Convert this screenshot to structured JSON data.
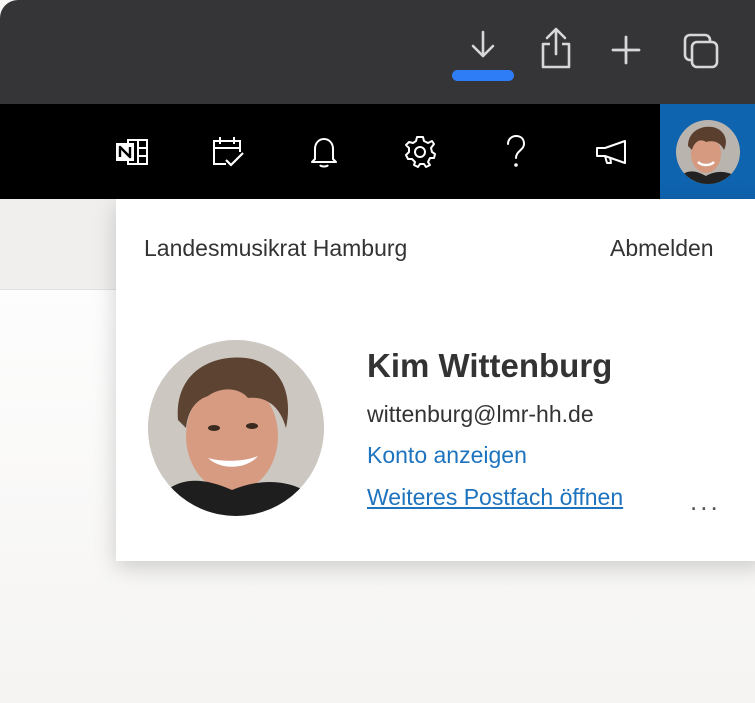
{
  "browser_toolbar": {
    "icons": [
      "download-icon",
      "share-icon",
      "new-tab-icon",
      "tab-overview-icon"
    ],
    "download_progress_color": "#2f7df6"
  },
  "header": {
    "icons": [
      "onenote-icon",
      "my-day-icon",
      "notifications-icon",
      "settings-icon",
      "help-icon",
      "feedback-icon"
    ],
    "background": "#000000",
    "avatar_tile_color": "#0f64b0"
  },
  "account_card": {
    "organization": "Landesmusikrat Hamburg",
    "sign_out_label": "Abmelden",
    "name": "Kim Wittenburg",
    "email": "wittenburg@lmr-hh.de",
    "view_account_label": "Konto anzeigen",
    "open_mailbox_label": "Weiteres Postfach öffnen",
    "more_label": "...",
    "link_color": "#1e73be"
  }
}
